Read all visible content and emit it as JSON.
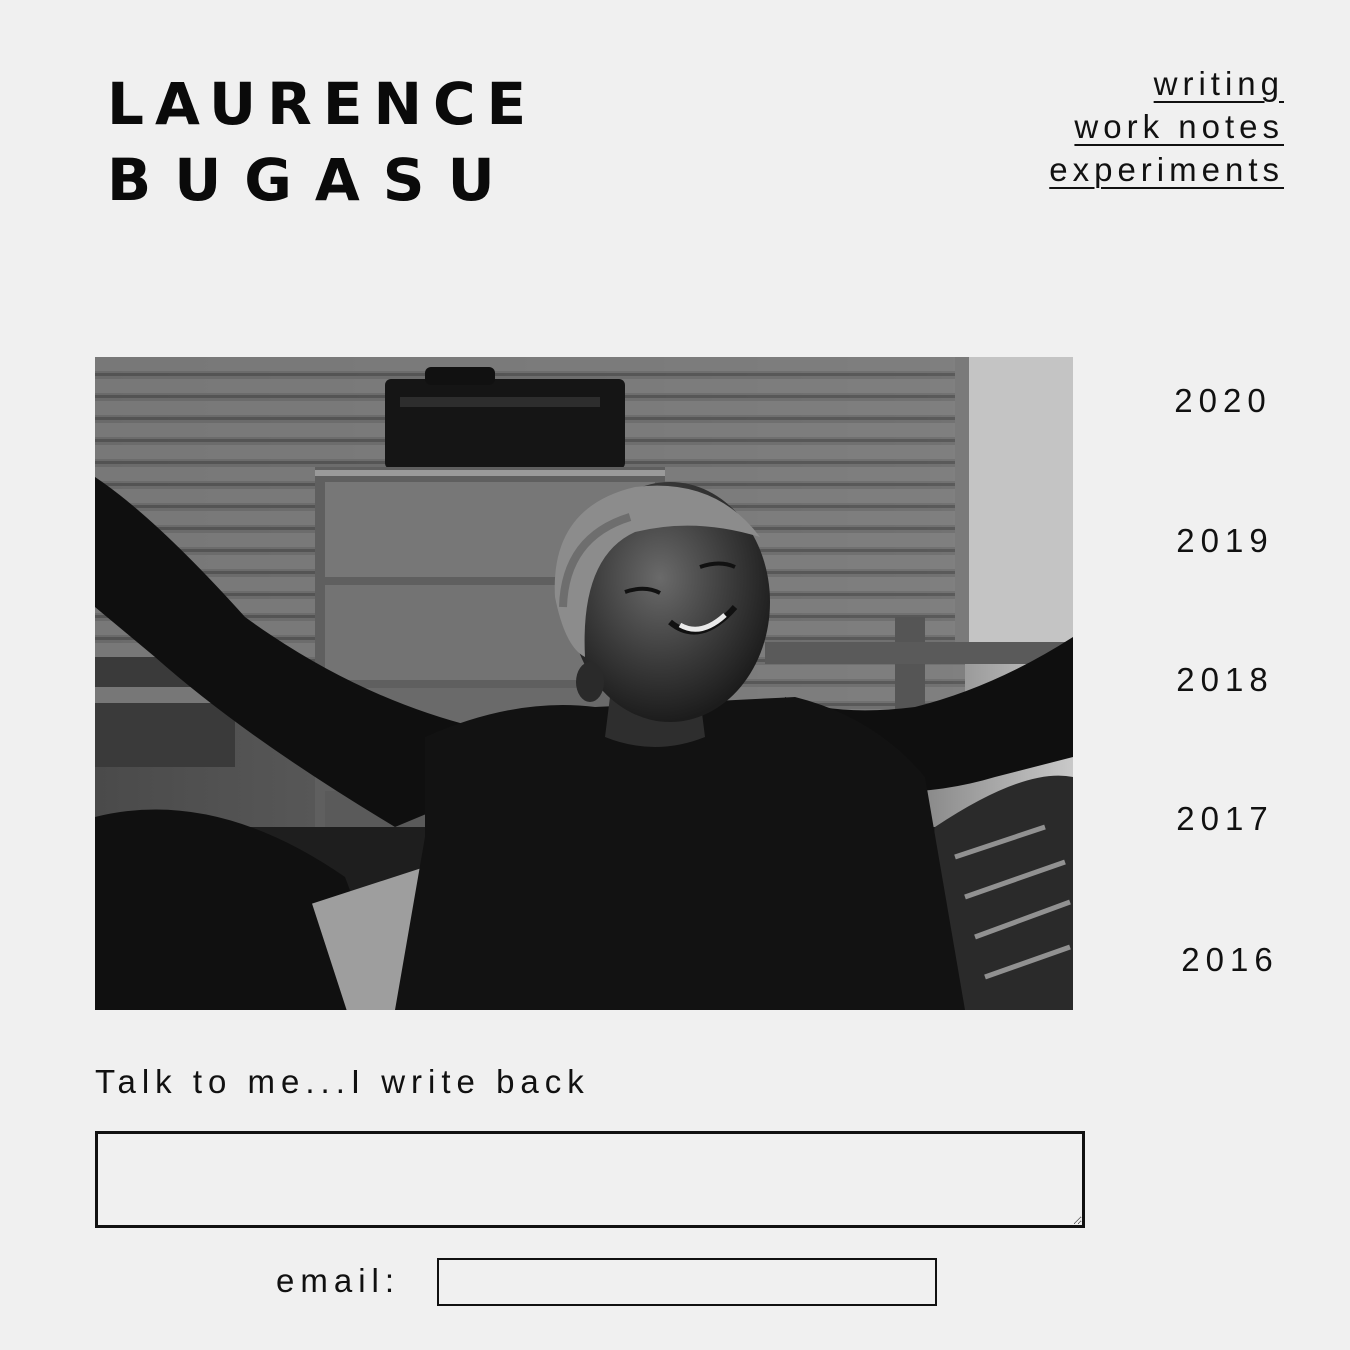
{
  "header": {
    "name_line1": "LAURENCE",
    "name_line2": "BUGASU"
  },
  "nav": {
    "items": [
      {
        "label": "writing"
      },
      {
        "label": "work notes"
      },
      {
        "label": "experiments"
      }
    ]
  },
  "years": [
    "2020",
    "2019",
    "2018",
    "2017",
    "2016"
  ],
  "contact": {
    "prompt": "Talk to me...I write back",
    "message_value": "",
    "email_label": "email:",
    "email_value": ""
  },
  "colors": {
    "background": "#f0f0f0",
    "text": "#111111"
  }
}
